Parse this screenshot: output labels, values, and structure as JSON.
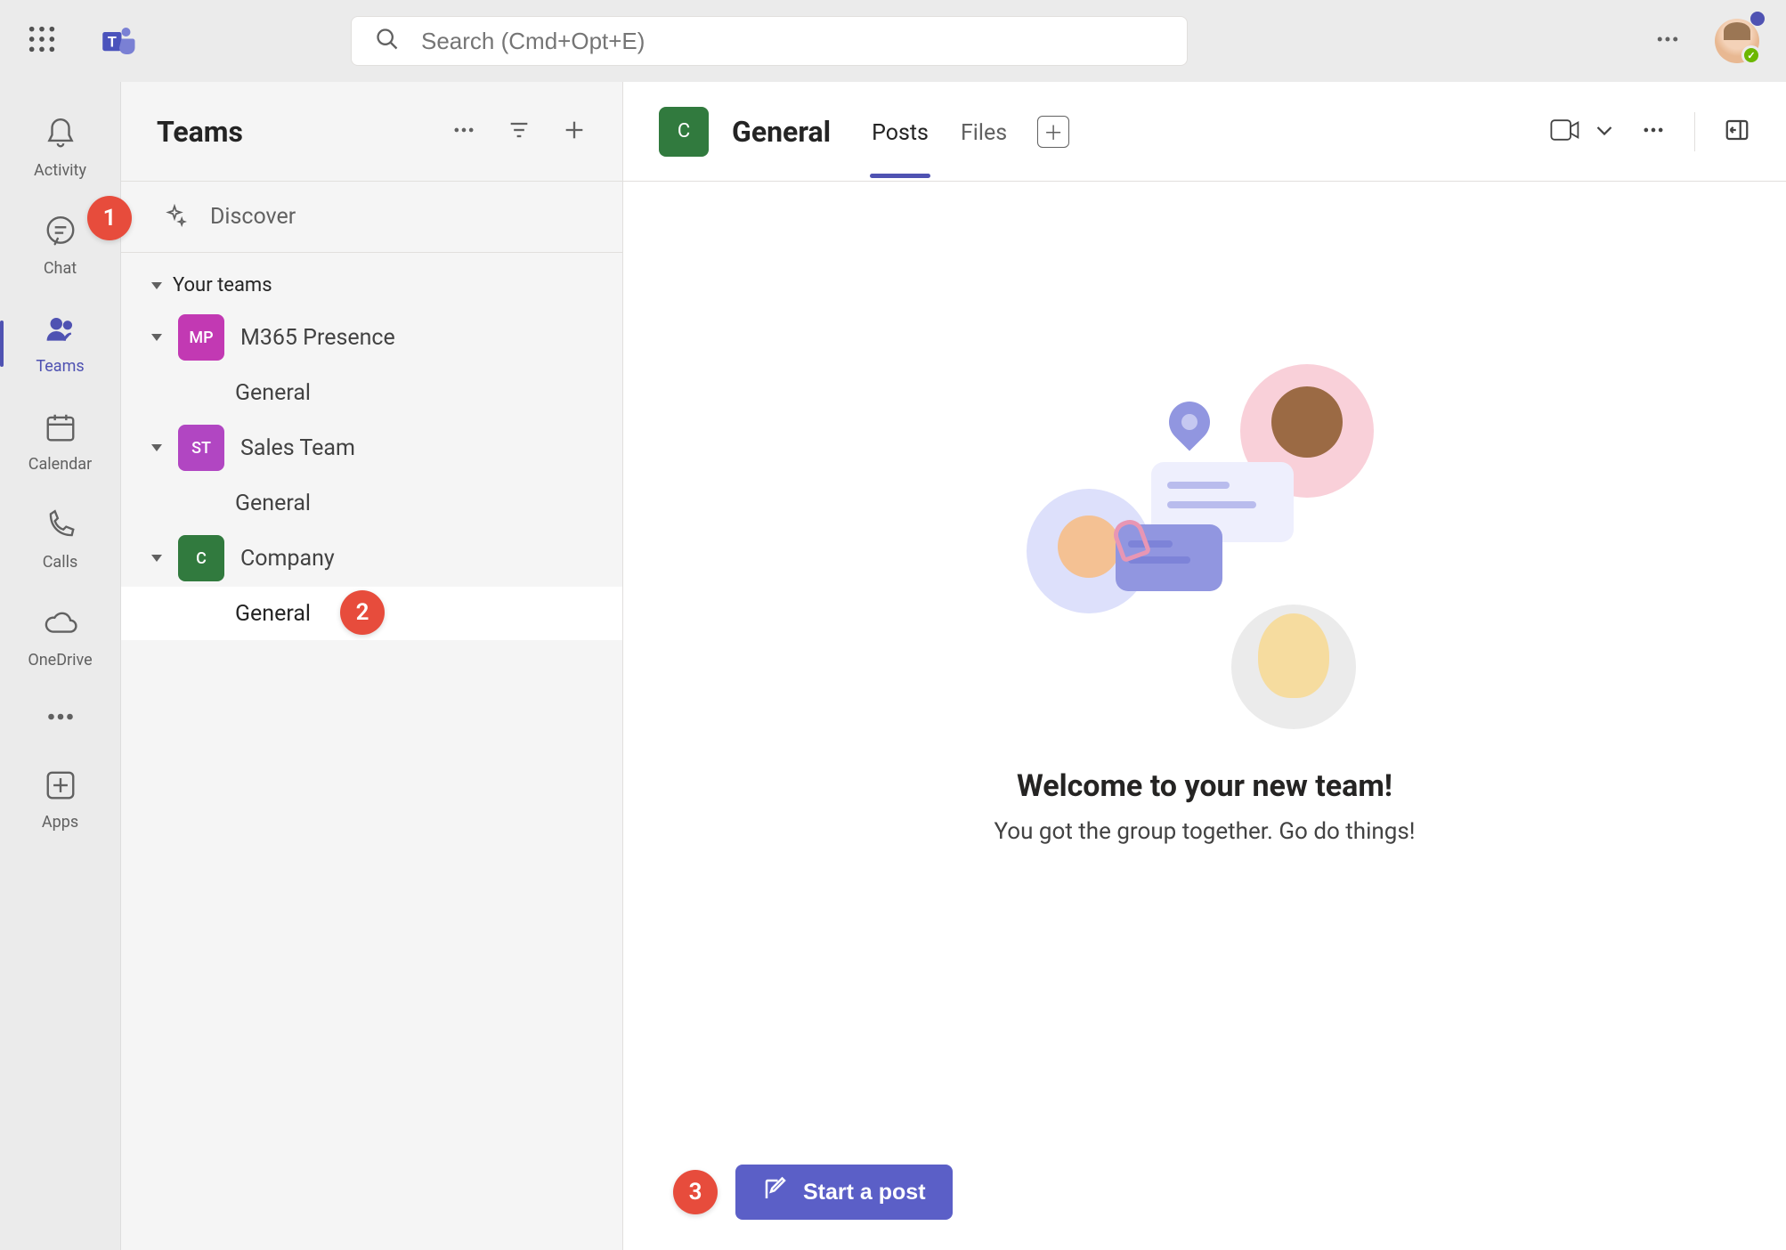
{
  "search": {
    "placeholder": "Search (Cmd+Opt+E)"
  },
  "rail": {
    "activity": "Activity",
    "chat": "Chat",
    "teams": "Teams",
    "calendar": "Calendar",
    "calls": "Calls",
    "onedrive": "OneDrive",
    "apps": "Apps"
  },
  "teamsPanel": {
    "title": "Teams",
    "discover": "Discover",
    "sectionLabel": "Your teams",
    "teams": [
      {
        "initials": "MP",
        "color": "#c239b3",
        "name": "M365 Presence",
        "channel": "General"
      },
      {
        "initials": "ST",
        "color": "#b146c2",
        "name": "Sales Team",
        "channel": "General"
      },
      {
        "initials": "C",
        "color": "#317a3e",
        "name": "Company",
        "channel": "General"
      }
    ]
  },
  "channelHeader": {
    "avatarInitials": "C",
    "name": "General",
    "tabs": {
      "posts": "Posts",
      "files": "Files"
    }
  },
  "welcome": {
    "title": "Welcome to your new team!",
    "subtitle": "You got the group together. Go do things!"
  },
  "postButton": "Start a post",
  "annotations": {
    "a1": "1",
    "a2": "2",
    "a3": "3"
  }
}
